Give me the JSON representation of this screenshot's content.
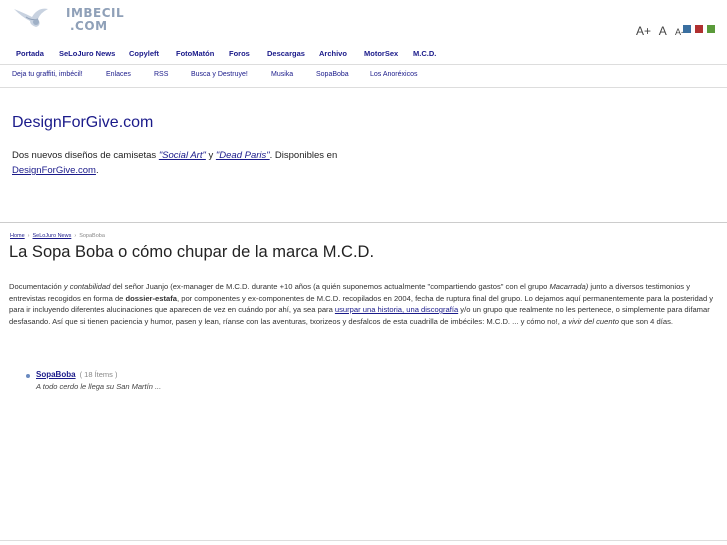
{
  "logo": {
    "line1": "IMBECIL",
    "line2": ".COM"
  },
  "font_size_controls": [
    "A+",
    "A",
    "A-"
  ],
  "color_swatches": [
    "#3a6fa0",
    "#b03030",
    "#5a9a3a"
  ],
  "nav_primary": [
    "Portada",
    "SeLoJuro News",
    "Copyleft",
    "FotoMatón",
    "Foros",
    "Descargas",
    "Archivo",
    "MotorSex",
    "M.C.D."
  ],
  "nav_secondary": [
    "Deja tu graffiti, imbécil!",
    "Enlaces",
    "RSS",
    "Busca y Destruye!",
    "Musika",
    "SopaBoba",
    "Los Anoréxicos"
  ],
  "promo": {
    "title": "DesignForGive.com",
    "text_before": "Dos nuevos diseños de camisetas ",
    "link1": "\"Social Art\"",
    "text_mid": " y ",
    "link2": "\"Dead Paris\"",
    "text_after": ". Disponibles en ",
    "link3": "DesignForGive.com",
    "text_end": "."
  },
  "breadcrumb": {
    "home": "Home",
    "section": "SeLoJuro News",
    "current": "SopaBoba"
  },
  "page_title": "La Sopa Boba o cómo chupar de la marca M.C.D.",
  "article": {
    "p1": "Documentación ",
    "em1": "y contabilidad",
    "p2": " del señor Juanjo (ex-manager de M.C.D. durante +10 años (a quién suponemos actualmente \"compartiendo gastos\" con el grupo ",
    "em2": "Macarrada)",
    "p3": " junto a diversos testimonios y entrevistas recogidos en forma de ",
    "strong1": "dossier-estafa",
    "p4": ", por componentes y ex-componentes de M.C.D. recopilados en 2004, fecha de ruptura final del grupo. Lo dejamos aquí permanentemente para la posteridad y para ir incluyendo diferentes alucinaciones que aparecen de vez en cuándo por ahí, ya sea para ",
    "link1": "usurpar una historia, una discografía",
    "p5": " y/o un grupo que realmente no les pertenece, o simplemente para difamar desfasando. Así que si tienen paciencia y humor, pasen y lean, ríanse con las aventuras, txorizeos y desfalcos de esta cuadrilla de imbéciles: M.C.D. ... y cómo no!, ",
    "em3": "a vivir del cuento",
    "p6": " que son 4 días."
  },
  "list_item": {
    "title": "SopaBoba",
    "count": "( 18 Ítems )",
    "desc": "A todo cerdo le llega su San Martín ..."
  }
}
